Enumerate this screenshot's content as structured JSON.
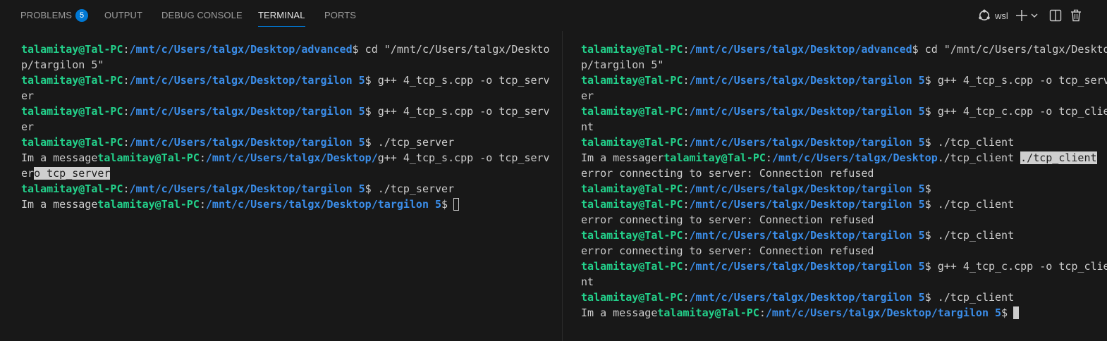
{
  "tabs": [
    {
      "label": "PROBLEMS",
      "badge": "5"
    },
    {
      "label": "OUTPUT"
    },
    {
      "label": "DEBUG CONSOLE"
    },
    {
      "label": "TERMINAL",
      "active": true
    },
    {
      "label": "PORTS"
    }
  ],
  "actions": {
    "profile_label": "wsl",
    "profile_icon": "linux-icon",
    "add_icon": "plus-icon",
    "dropdown_icon": "chevron-down-icon",
    "split_icon": "split-icon",
    "trash_icon": "trash-icon"
  },
  "colors": {
    "accent": "#0078d4",
    "user": "#23d18b",
    "path": "#3b8eea",
    "text": "#cccccc",
    "background": "#181818"
  },
  "left_terminal": {
    "lines": [
      [
        {
          "c": "u",
          "t": "talamitay@Tal-PC"
        },
        {
          "c": "t",
          "t": ":"
        },
        {
          "c": "p",
          "t": "/mnt/c/Users/talgx/Desktop/advanced"
        },
        {
          "c": "t",
          "t": "$ cd \"/mnt/c/Users/talgx/Deskto"
        }
      ],
      [
        {
          "c": "t",
          "t": "p/targilon 5\""
        }
      ],
      [
        {
          "c": "u",
          "t": "talamitay@Tal-PC"
        },
        {
          "c": "t",
          "t": ":"
        },
        {
          "c": "p",
          "t": "/mnt/c/Users/talgx/Desktop/targilon 5"
        },
        {
          "c": "t",
          "t": "$ g++ 4_tcp_s.cpp -o tcp_serv"
        }
      ],
      [
        {
          "c": "t",
          "t": "er"
        }
      ],
      [
        {
          "c": "u",
          "t": "talamitay@Tal-PC"
        },
        {
          "c": "t",
          "t": ":"
        },
        {
          "c": "p",
          "t": "/mnt/c/Users/talgx/Desktop/targilon 5"
        },
        {
          "c": "t",
          "t": "$ g++ 4_tcp_s.cpp -o tcp_serv"
        }
      ],
      [
        {
          "c": "t",
          "t": "er"
        }
      ],
      [
        {
          "c": "u",
          "t": "talamitay@Tal-PC"
        },
        {
          "c": "t",
          "t": ":"
        },
        {
          "c": "p",
          "t": "/mnt/c/Users/talgx/Desktop/targilon 5"
        },
        {
          "c": "t",
          "t": "$ ./tcp_server"
        }
      ],
      [
        {
          "c": "t",
          "t": "Im a message"
        },
        {
          "c": "u",
          "t": "talamitay@Tal-PC"
        },
        {
          "c": "t",
          "t": ":"
        },
        {
          "c": "p",
          "t": "/mnt/c/Users/talgx/Desktop/"
        },
        {
          "c": "t",
          "t": "g++ 4_tcp_s.cpp -o tcp_serv"
        }
      ],
      [
        {
          "c": "t",
          "t": "er"
        },
        {
          "c": "sel",
          "t": "o tcp_server"
        }
      ],
      [
        {
          "c": "u",
          "t": "talamitay@Tal-PC"
        },
        {
          "c": "t",
          "t": ":"
        },
        {
          "c": "p",
          "t": "/mnt/c/Users/talgx/Desktop/targilon 5"
        },
        {
          "c": "t",
          "t": "$ ./tcp_server"
        }
      ],
      [
        {
          "c": "t",
          "t": "Im a message"
        },
        {
          "c": "u",
          "t": "talamitay@Tal-PC"
        },
        {
          "c": "t",
          "t": ":"
        },
        {
          "c": "p",
          "t": "/mnt/c/Users/talgx/Desktop/targilon 5"
        },
        {
          "c": "t",
          "t": "$"
        },
        {
          "c": "cursor-hollow",
          "t": ""
        }
      ]
    ]
  },
  "right_terminal": {
    "lines": [
      [
        {
          "c": "u",
          "t": "talamitay@Tal-PC"
        },
        {
          "c": "t",
          "t": ":"
        },
        {
          "c": "p",
          "t": "/mnt/c/Users/talgx/Desktop/advanced"
        },
        {
          "c": "t",
          "t": "$ cd \"/mnt/c/Users/talgx/Deskto"
        }
      ],
      [
        {
          "c": "t",
          "t": "p/targilon 5\""
        }
      ],
      [
        {
          "c": "u",
          "t": "talamitay@Tal-PC"
        },
        {
          "c": "t",
          "t": ":"
        },
        {
          "c": "p",
          "t": "/mnt/c/Users/talgx/Desktop/targilon 5"
        },
        {
          "c": "t",
          "t": "$ g++ 4_tcp_s.cpp -o tcp_serv"
        }
      ],
      [
        {
          "c": "t",
          "t": "er"
        }
      ],
      [
        {
          "c": "u",
          "t": "talamitay@Tal-PC"
        },
        {
          "c": "t",
          "t": ":"
        },
        {
          "c": "p",
          "t": "/mnt/c/Users/talgx/Desktop/targilon 5"
        },
        {
          "c": "t",
          "t": "$ g++ 4_tcp_c.cpp -o tcp_clie"
        }
      ],
      [
        {
          "c": "t",
          "t": "nt"
        }
      ],
      [
        {
          "c": "u",
          "t": "talamitay@Tal-PC"
        },
        {
          "c": "t",
          "t": ":"
        },
        {
          "c": "p",
          "t": "/mnt/c/Users/talgx/Desktop/targilon 5"
        },
        {
          "c": "t",
          "t": "$ ./tcp_client"
        }
      ],
      [
        {
          "c": "t",
          "t": "Im a messager"
        },
        {
          "c": "u",
          "t": "talamitay@Tal-PC"
        },
        {
          "c": "t",
          "t": ":"
        },
        {
          "c": "p",
          "t": "/mnt/c/Users/talgx/Desktop"
        },
        {
          "c": "t",
          "t": "./tcp_client "
        },
        {
          "c": "sel",
          "t": "./tcp_client"
        }
      ],
      [
        {
          "c": "t",
          "t": "error connecting to server: Connection refused"
        }
      ],
      [
        {
          "c": "u",
          "t": "talamitay@Tal-PC"
        },
        {
          "c": "t",
          "t": ":"
        },
        {
          "c": "p",
          "t": "/mnt/c/Users/talgx/Desktop/targilon 5"
        },
        {
          "c": "t",
          "t": "$"
        }
      ],
      [
        {
          "c": "u",
          "t": "talamitay@Tal-PC"
        },
        {
          "c": "t",
          "t": ":"
        },
        {
          "c": "p",
          "t": "/mnt/c/Users/talgx/Desktop/targilon 5"
        },
        {
          "c": "t",
          "t": "$ ./tcp_client"
        }
      ],
      [
        {
          "c": "t",
          "t": "error connecting to server: Connection refused"
        }
      ],
      [
        {
          "c": "u",
          "t": "talamitay@Tal-PC"
        },
        {
          "c": "t",
          "t": ":"
        },
        {
          "c": "p",
          "t": "/mnt/c/Users/talgx/Desktop/targilon 5"
        },
        {
          "c": "t",
          "t": "$ ./tcp_client"
        }
      ],
      [
        {
          "c": "t",
          "t": "error connecting to server: Connection refused"
        }
      ],
      [
        {
          "c": "u",
          "t": "talamitay@Tal-PC"
        },
        {
          "c": "t",
          "t": ":"
        },
        {
          "c": "p",
          "t": "/mnt/c/Users/talgx/Desktop/targilon 5"
        },
        {
          "c": "t",
          "t": "$ g++ 4_tcp_c.cpp -o tcp_clie"
        }
      ],
      [
        {
          "c": "t",
          "t": "nt"
        }
      ],
      [
        {
          "c": "u",
          "t": "talamitay@Tal-PC"
        },
        {
          "c": "t",
          "t": ":"
        },
        {
          "c": "p",
          "t": "/mnt/c/Users/talgx/Desktop/targilon 5"
        },
        {
          "c": "t",
          "t": "$ ./tcp_client"
        }
      ],
      [
        {
          "c": "t",
          "t": "Im a message"
        },
        {
          "c": "u",
          "t": "talamitay@Tal-PC"
        },
        {
          "c": "t",
          "t": ":"
        },
        {
          "c": "p",
          "t": "/mnt/c/Users/talgx/Desktop/targilon 5"
        },
        {
          "c": "t",
          "t": "$"
        },
        {
          "c": "cursor-solid",
          "t": ""
        }
      ]
    ]
  }
}
